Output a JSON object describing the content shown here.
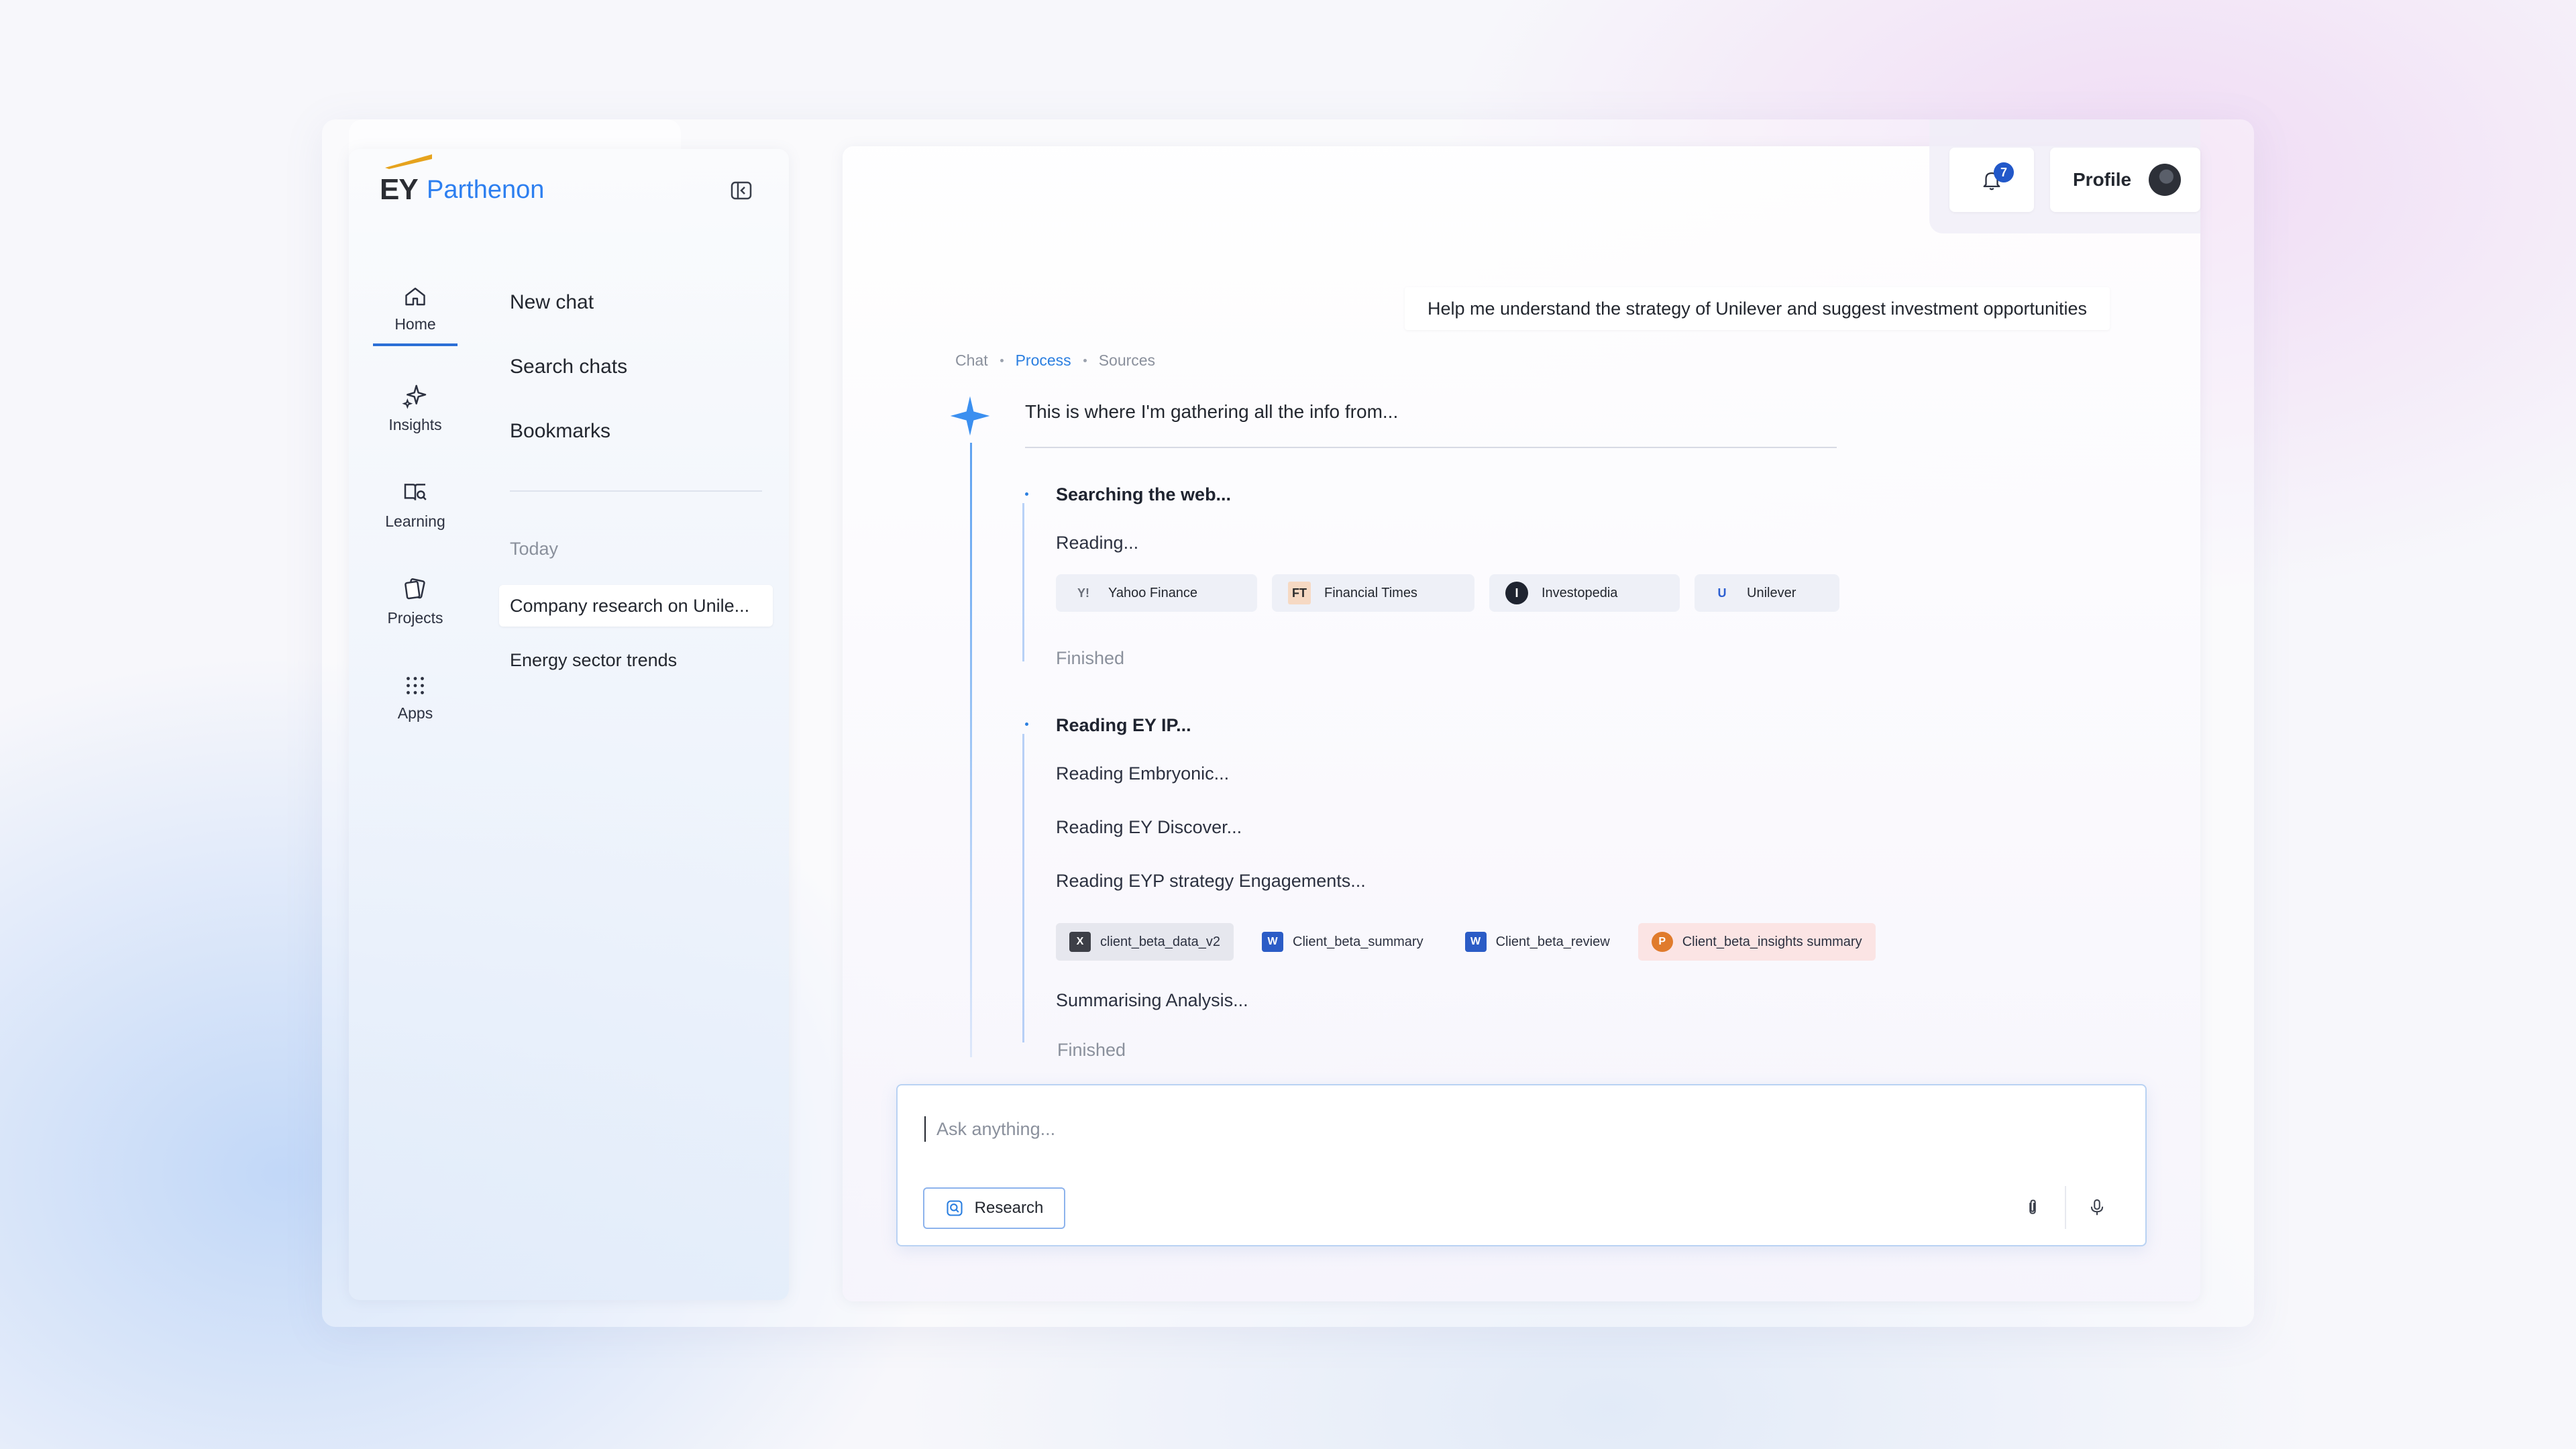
{
  "brand": {
    "mark": "EY",
    "name": "Parthenon",
    "beam_color": "#e6a31d",
    "accent": "#2d7ff0"
  },
  "rail": [
    {
      "label": "Home",
      "icon": "home-icon",
      "active": true
    },
    {
      "label": "Insights",
      "icon": "sparkles-icon"
    },
    {
      "label": "Learning",
      "icon": "book-search-icon"
    },
    {
      "label": "Projects",
      "icon": "cards-icon"
    },
    {
      "label": "Apps",
      "icon": "grid-dots-icon"
    }
  ],
  "nav": {
    "new_chat": "New chat",
    "search_chats": "Search chats",
    "bookmarks": "Bookmarks"
  },
  "history": {
    "group_label": "Today",
    "items": [
      "Company research on Unile...",
      "Energy sector trends"
    ]
  },
  "header": {
    "notifications_count": "7",
    "profile_label": "Profile"
  },
  "chat": {
    "user_message": "Help me understand the strategy of Unilever and suggest investment opportunities",
    "tabs": [
      "Chat",
      "Process",
      "Sources"
    ],
    "active_tab": "Process",
    "intro": "This is where I'm gathering all the info from...",
    "web_step": {
      "title": "Searching the web...",
      "reading": "Reading...",
      "sources": [
        {
          "name": "Yahoo Finance",
          "glyph": "Y!"
        },
        {
          "name": "Financial Times",
          "glyph": "FT"
        },
        {
          "name": "Investopedia",
          "glyph": "I"
        },
        {
          "name": "Unilever",
          "glyph": "U"
        }
      ],
      "status": "Finished"
    },
    "ip_step": {
      "title": "Reading EY IP...",
      "lines": [
        "Reading Embryonic...",
        "Reading EY Discover...",
        "Reading EYP strategy Engagements..."
      ],
      "files": [
        {
          "name": "client_beta_data_v2",
          "type": "excel",
          "color": "#3d3f47"
        },
        {
          "name": "Client_beta_summary",
          "type": "word",
          "color": "#2b5cc6"
        },
        {
          "name": "Client_beta_review",
          "type": "word",
          "color": "#2b5cc6"
        },
        {
          "name": "Client_beta_insights summary",
          "type": "powerpoint",
          "color": "#e07b2c"
        }
      ],
      "summarising": "Summarising Analysis...",
      "status": "Finished"
    }
  },
  "composer": {
    "placeholder": "Ask anything...",
    "research_label": "Research"
  }
}
